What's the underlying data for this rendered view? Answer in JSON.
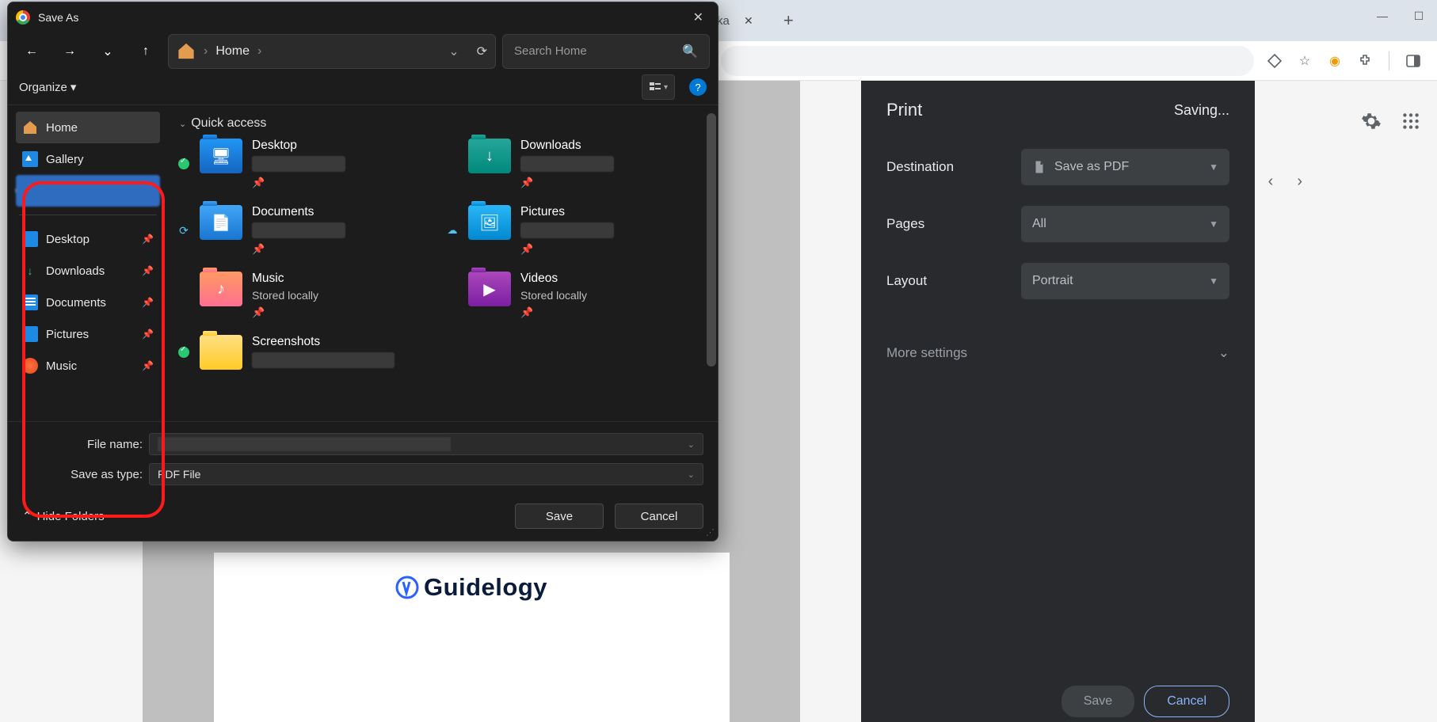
{
  "browser": {
    "tab_partial_text": "ka",
    "toolbar_icons": [
      "diamond-icon",
      "star-icon",
      "power-icon",
      "extension-icon",
      "sidepanel-icon"
    ]
  },
  "page": {
    "brand": "Guidelogy"
  },
  "print_panel": {
    "title": "Print",
    "status": "Saving...",
    "destination_label": "Destination",
    "destination_value": "Save as PDF",
    "pages_label": "Pages",
    "pages_value": "All",
    "layout_label": "Layout",
    "layout_value": "Portrait",
    "more_settings": "More settings",
    "save_btn": "Save",
    "cancel_btn": "Cancel"
  },
  "dialog": {
    "title": "Save As",
    "breadcrumb": "Home",
    "search_placeholder": "Search Home",
    "organize": "Organize",
    "quick_access": "Quick access",
    "sidebar": {
      "home": "Home",
      "gallery": "Gallery",
      "desktop": "Desktop",
      "downloads": "Downloads",
      "documents": "Documents",
      "pictures": "Pictures",
      "music": "Music"
    },
    "folders": {
      "desktop": "Desktop",
      "downloads": "Downloads",
      "documents": "Documents",
      "pictures": "Pictures",
      "music": "Music",
      "music_sub": "Stored locally",
      "videos": "Videos",
      "videos_sub": "Stored locally",
      "screenshots": "Screenshots"
    },
    "file_name_label": "File name:",
    "save_type_label": "Save as type:",
    "save_type_value": "PDF File",
    "hide_folders": "Hide Folders",
    "save_btn": "Save",
    "cancel_btn": "Cancel"
  }
}
